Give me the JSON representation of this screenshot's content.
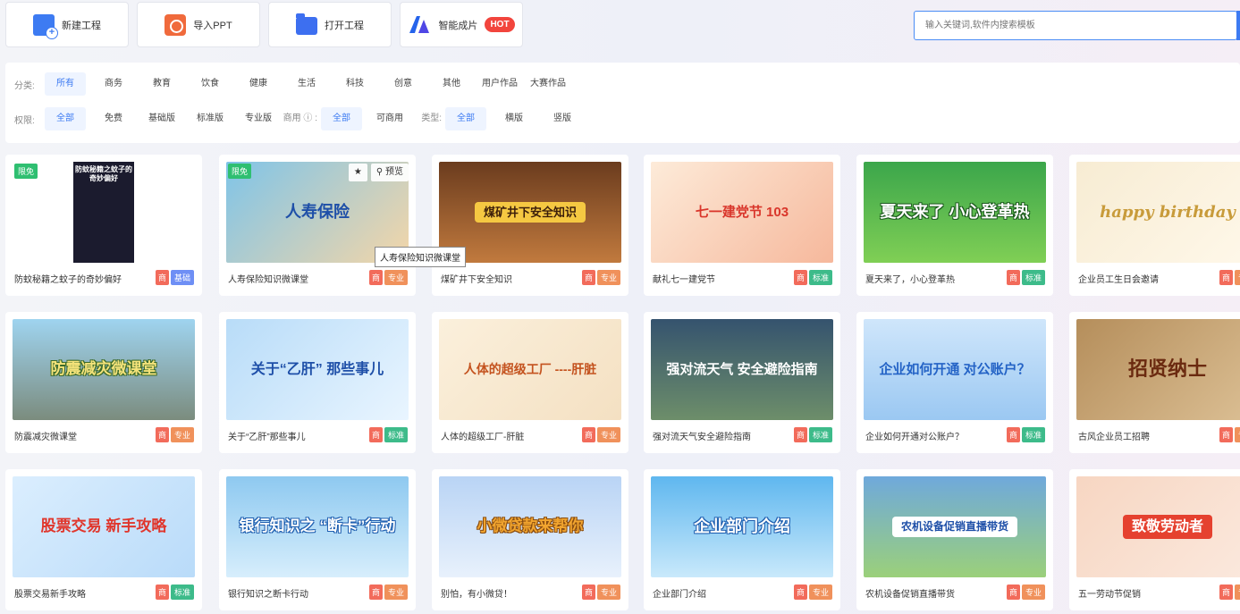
{
  "toolbar": {
    "new_project": "新建工程",
    "import_ppt": "导入PPT",
    "open_project": "打开工程",
    "smart_video": "智能成片",
    "hot_badge": "HOT"
  },
  "search": {
    "placeholder": "输入关键词,软件内搜索模板"
  },
  "filters": {
    "category_label": "分类:",
    "categories": [
      "所有",
      "商务",
      "教育",
      "饮食",
      "健康",
      "生活",
      "科技",
      "创意",
      "其他",
      "用户作品",
      "大赛作品"
    ],
    "permission_label": "权限:",
    "permissions": [
      "全部",
      "免费",
      "基础版",
      "标准版",
      "专业版"
    ],
    "commercial_label": "商用 ⓘ :",
    "commercial": [
      "全部",
      "可商用"
    ],
    "type_label": "类型:",
    "types": [
      "全部",
      "横版",
      "竖版"
    ]
  },
  "card_common": {
    "shang_badge": "商",
    "free_badge": "限免",
    "preview": "预览"
  },
  "tooltip": "人寿保险知识微课堂",
  "cards": [
    {
      "title": "防蚊秘籍之蚊子的奇妙偏好",
      "level": "基础",
      "thumb_text": "防蚊秘籍之蚊子的奇妙偏好"
    },
    {
      "title": "人寿保险知识微课堂",
      "level": "专业",
      "thumb_text": "人寿保险"
    },
    {
      "title": "煤矿井下安全知识",
      "level": "专业",
      "thumb_text": "煤矿井下安全知识"
    },
    {
      "title": "献礼七一建党节",
      "level": "标准",
      "thumb_text": "七一建党节 103"
    },
    {
      "title": "夏天来了，小心登革热",
      "level": "标准",
      "thumb_text": "夏天来了 小心登革热"
    },
    {
      "title": "企业员工生日会邀请",
      "level": "专业",
      "thumb_text": "happy birthday"
    },
    {
      "title": "防震减灾微课堂",
      "level": "专业",
      "thumb_text": "防震减灾微课堂"
    },
    {
      "title": "关于“乙肝”那些事儿",
      "level": "标准",
      "thumb_text": "关于“乙肝” 那些事儿"
    },
    {
      "title": "人体的超级工厂-肝脏",
      "level": "专业",
      "thumb_text": "人体的超级工厂 ----肝脏"
    },
    {
      "title": "强对流天气安全避险指南",
      "level": "标准",
      "thumb_text": "强对流天气 安全避险指南"
    },
    {
      "title": "企业如何开通对公账户？",
      "level": "标准",
      "thumb_text": "企业如何开通 对公账户？"
    },
    {
      "title": "古风企业员工招聘",
      "level": "专业",
      "thumb_text": "招贤纳士"
    },
    {
      "title": "股票交易新手攻略",
      "level": "标准",
      "thumb_text": "股票交易 新手攻略"
    },
    {
      "title": "银行知识之断卡行动",
      "level": "专业",
      "thumb_text": "银行知识之 “断卡”行动"
    },
    {
      "title": "别怕，有小微贷！",
      "level": "专业",
      "thumb_text": "小微贷款来帮你"
    },
    {
      "title": "企业部门介绍",
      "level": "专业",
      "thumb_text": "企业部门介绍"
    },
    {
      "title": "农机设备促销直播带货",
      "level": "专业",
      "thumb_text": "农机设备促销直播带货"
    },
    {
      "title": "五一劳动节促销",
      "level": "专业",
      "thumb_text": "致敬劳动者"
    }
  ],
  "colors": {
    "accent": "#3d7bf2",
    "badge_commercial": "#f26b5b",
    "badge_basic": "#6e8ff5",
    "badge_pro": "#f0915b",
    "badge_standard": "#3dbb8a",
    "badge_free": "#2fbf71",
    "hot": "#f2453d"
  },
  "icons": {
    "new_project": "new-project-icon",
    "import_ppt": "ppt-icon",
    "open_project": "folder-icon",
    "smart_video": "ai-logo-icon",
    "favorite": "star-icon",
    "preview": "search-icon"
  }
}
